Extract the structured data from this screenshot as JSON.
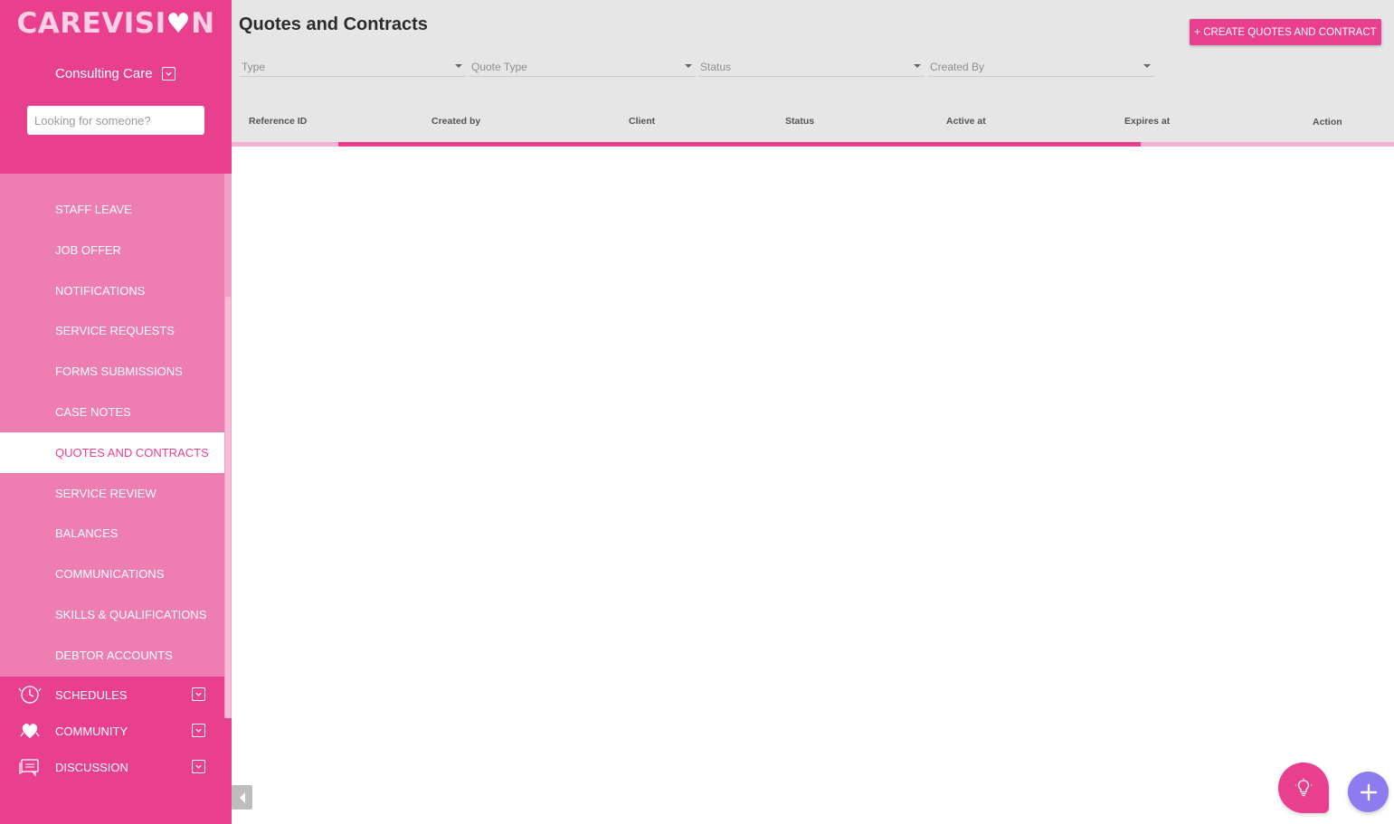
{
  "brand": {
    "name_part1": "CAREVISI",
    "name_part2": "N"
  },
  "org": {
    "name": "Consulting Care"
  },
  "search": {
    "placeholder": "Looking for someone?"
  },
  "sidebar": {
    "submenu_items": [
      {
        "label": "STAFF LEAVE",
        "active": false
      },
      {
        "label": "JOB OFFER",
        "active": false
      },
      {
        "label": "NOTIFICATIONS",
        "active": false
      },
      {
        "label": "SERVICE REQUESTS",
        "active": false
      },
      {
        "label": "FORMS SUBMISSIONS",
        "active": false
      },
      {
        "label": "CASE NOTES",
        "active": false
      },
      {
        "label": "QUOTES AND CONTRACTS",
        "active": true
      },
      {
        "label": "SERVICE REVIEW",
        "active": false
      },
      {
        "label": "BALANCES",
        "active": false
      },
      {
        "label": "COMMUNICATIONS",
        "active": false
      },
      {
        "label": "SKILLS & QUALIFICATIONS",
        "active": false
      },
      {
        "label": "DEBTOR ACCOUNTS",
        "active": false
      }
    ],
    "main_items": [
      {
        "label": "SCHEDULES",
        "icon": "clock-icon"
      },
      {
        "label": "COMMUNITY",
        "icon": "heart-hand-icon"
      },
      {
        "label": "DISCUSSION",
        "icon": "chat-icon"
      }
    ]
  },
  "page": {
    "title": "Quotes and Contracts",
    "create_button": "+ CREATE QUOTES AND CONTRACT"
  },
  "filters": [
    {
      "label": "Type"
    },
    {
      "label": "Quote Type"
    },
    {
      "label": "Status"
    },
    {
      "label": "Created By"
    }
  ],
  "table": {
    "columns": [
      "Reference ID",
      "Created by",
      "Client",
      "Status",
      "Active at",
      "Expires at",
      "Action"
    ]
  },
  "loading": {
    "progress": 0.76
  },
  "colors": {
    "primary": "#e8408f",
    "primary_light": "#ee7eb2",
    "fab_secondary": "#8c7cf0"
  }
}
